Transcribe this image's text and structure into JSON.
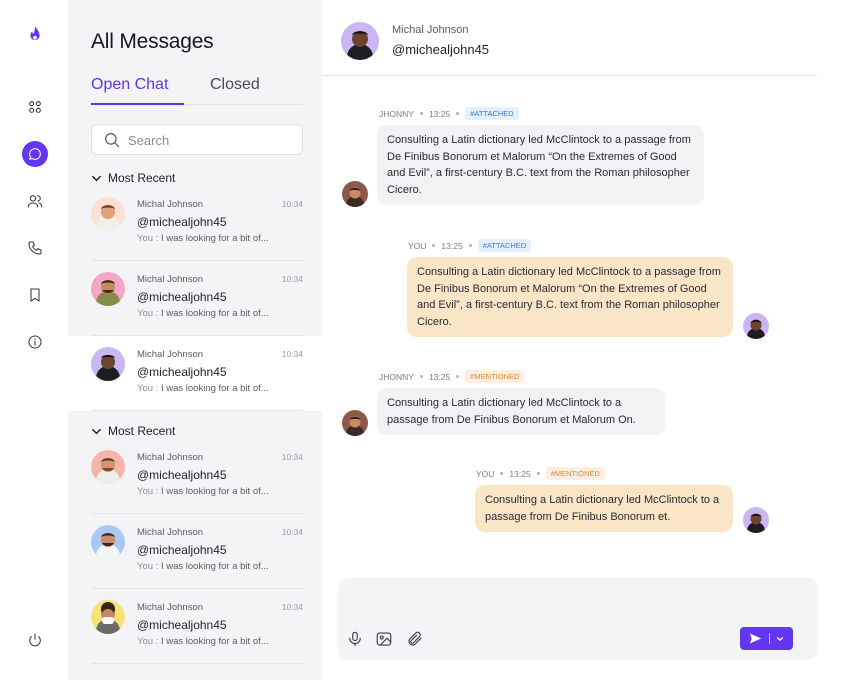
{
  "colors": {
    "accent": "#6336f0",
    "incoming_bubble": "#f2f2f4",
    "outgoing_bubble": "#f9e6c7",
    "panel": "#f4f4f6"
  },
  "rail": {
    "items": [
      {
        "icon": "flame-logo-icon"
      },
      {
        "icon": "apps-grid-icon"
      },
      {
        "icon": "chat-icon",
        "active": true
      },
      {
        "icon": "users-icon"
      },
      {
        "icon": "phone-icon"
      },
      {
        "icon": "bookmark-icon"
      },
      {
        "icon": "info-icon"
      },
      {
        "icon": "power-icon"
      }
    ]
  },
  "list": {
    "title": "All Messages",
    "tabs": [
      {
        "label": "Open Chat"
      },
      {
        "label": "Closed"
      }
    ],
    "search_placeholder": "Search",
    "sections": [
      {
        "heading": "Most Recent",
        "chats": [
          {
            "name": "Michal Johnson",
            "time": "10:34",
            "handle": "@michealjohn45",
            "you": "You :",
            "preview": " I was looking for a bit of..."
          },
          {
            "name": "Michal Johnson",
            "time": "10:34",
            "handle": "@michealjohn45",
            "you": "You :",
            "preview": " I was looking for a bit of..."
          },
          {
            "name": "Michal Johnson",
            "time": "10:34",
            "handle": "@michealjohn45",
            "you": "You :",
            "preview": " I was looking for a bit of..."
          }
        ]
      },
      {
        "heading": "Most Recent",
        "chats": [
          {
            "name": "Michal Johnson",
            "time": "10:34",
            "handle": "@michealjohn45",
            "you": "You :",
            "preview": " I was looking for a bit of..."
          },
          {
            "name": "Michal Johnson",
            "time": "10:34",
            "handle": "@michealjohn45",
            "you": "You :",
            "preview": " I was looking for a bit of..."
          },
          {
            "name": "Michal Johnson",
            "time": "10:34",
            "handle": "@michealjohn45",
            "you": "You :",
            "preview": " I was looking for a bit of..."
          }
        ]
      }
    ]
  },
  "conversation": {
    "name": "Michal Johnson",
    "handle": "@michealjohn45",
    "messages": [
      {
        "sender": "JHONNY",
        "time": "13:25",
        "tag": "#ATTACHED",
        "text": "Consulting a Latin dictionary led McClintock to a passage from De Finibus Bonorum et Malorum “On the Extremes of Good and Evil”, a first-century B.C. text from the Roman philosopher Cicero."
      },
      {
        "sender": "YOU",
        "time": "13:25",
        "tag": "#ATTACHED",
        "text": "Consulting a Latin dictionary led McClintock to a passage from De Finibus Bonorum et Malorum “On the Extremes of Good and Evil”, a first-century B.C. text from the Roman philosopher Cicero."
      },
      {
        "sender": "JHONNY",
        "time": "13:25",
        "tag": "#MENTIONED",
        "text": "Consulting a Latin dictionary led McClintock to a passage from De Finibus Bonorum et Malorum  On."
      },
      {
        "sender": "YOU",
        "time": "13:25",
        "tag": "#MENTIONED",
        "text": "Consulting a Latin dictionary led McClintock to a passage from De Finibus Bonorum et."
      }
    ],
    "composer": {
      "icons": [
        "mic-icon",
        "image-icon",
        "attachment-icon"
      ],
      "send_icon": "send-icon"
    }
  }
}
